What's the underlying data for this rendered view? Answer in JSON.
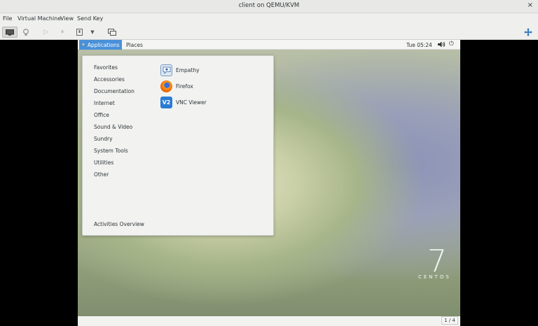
{
  "window": {
    "title": "client on QEMU/KVM",
    "close_glyph": "×"
  },
  "menubar": [
    "File",
    "Virtual Machine",
    "View",
    "Send Key"
  ],
  "toolbar": {
    "icons": [
      "console-icon",
      "lightbulb-icon",
      "play-icon",
      "pause-icon",
      "power-icon",
      "dropdown-icon",
      "snapshot-icon",
      "fullscreen-icon"
    ]
  },
  "guest": {
    "topbar": {
      "applications_label": "Applications",
      "places_label": "Places",
      "clock": "Tue 05:24"
    },
    "menu": {
      "categories": [
        "Favorites",
        "Accessories",
        "Documentation",
        "Internet",
        "Office",
        "Sound & Video",
        "Sundry",
        "System Tools",
        "Utilities",
        "Other"
      ],
      "footer": "Activities Overview",
      "apps": [
        {
          "label": "Empathy",
          "icon": "empathy-icon"
        },
        {
          "label": "Firefox",
          "icon": "firefox-icon"
        },
        {
          "label": "VNC Viewer",
          "icon": "vnc-viewer-icon"
        }
      ]
    },
    "brand": {
      "number": "7",
      "word": "CENTOS"
    },
    "workspace": "1 / 4"
  }
}
